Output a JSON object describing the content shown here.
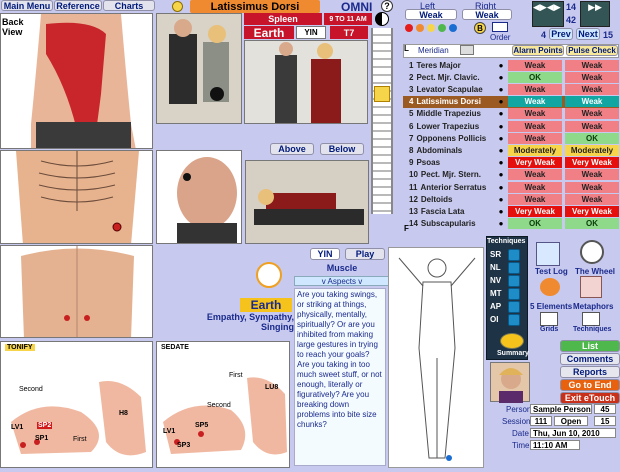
{
  "toolbar": {
    "main_menu": "Main Menu",
    "reference": "Reference",
    "charts": "Charts"
  },
  "header": {
    "muscle_title": "Latissimus Dorsi",
    "brand": "OMNI",
    "help": "?"
  },
  "back_view": "Back View",
  "organ": {
    "name": "Spleen",
    "time": "9 TO 11 AM",
    "element": "Earth",
    "yin": "YIN",
    "vertebra": "T7"
  },
  "sides": {
    "left_label": "Left",
    "right_label": "Right",
    "left_value": "Weak",
    "right_value": "Weak",
    "nav_top": "14",
    "nav_bottom": "42",
    "order_label": "Order",
    "counter_left": "4",
    "prev": "Prev",
    "next": "Next",
    "counter_right": "15"
  },
  "table_header": {
    "meridian": "Meridian",
    "alarm": "Alarm Points",
    "pulse": "Pulse Check"
  },
  "rows": [
    {
      "num": "1",
      "name": "Teres Major",
      "left": "Weak",
      "right": "Weak",
      "lc": "weak",
      "rc": "weak"
    },
    {
      "num": "2",
      "name": "Pect. Mjr. Clavic.",
      "left": "OK",
      "right": "Weak",
      "lc": "ok",
      "rc": "weak"
    },
    {
      "num": "3",
      "name": "Levator Scapulae",
      "left": "Weak",
      "right": "Weak",
      "lc": "weak",
      "rc": "weak"
    },
    {
      "num": "4",
      "name": "Latissimus Dorsi",
      "left": "Weak",
      "right": "Weak",
      "lc": "sel",
      "rc": "sel"
    },
    {
      "num": "5",
      "name": "Middle Trapezius",
      "left": "Weak",
      "right": "Weak",
      "lc": "weak",
      "rc": "weak"
    },
    {
      "num": "6",
      "name": "Lower Trapezius",
      "left": "Weak",
      "right": "Weak",
      "lc": "weak",
      "rc": "weak"
    },
    {
      "num": "7",
      "name": "Opponens Pollicis",
      "left": "Weak",
      "right": "OK",
      "lc": "weak",
      "rc": "ok"
    },
    {
      "num": "8",
      "name": "Abdominals",
      "left": "Moderately",
      "right": "Moderately",
      "lc": "mod",
      "rc": "mod"
    },
    {
      "num": "9",
      "name": "Psoas",
      "left": "Very Weak",
      "right": "Very Weak",
      "lc": "vweak",
      "rc": "vweak"
    },
    {
      "num": "10",
      "name": "Pect. Mjr. Stern.",
      "left": "Weak",
      "right": "Weak",
      "lc": "weak",
      "rc": "weak"
    },
    {
      "num": "11",
      "name": "Anterior Serratus",
      "left": "Weak",
      "right": "Weak",
      "lc": "weak",
      "rc": "weak"
    },
    {
      "num": "12",
      "name": "Deltoids",
      "left": "Weak",
      "right": "Weak",
      "lc": "weak",
      "rc": "weak"
    },
    {
      "num": "13",
      "name": "Fascia Lata",
      "left": "Very Weak",
      "right": "Very Weak",
      "lc": "vweak",
      "rc": "vweak"
    },
    {
      "num": "14",
      "name": "Subscapularis",
      "left": "OK",
      "right": "OK",
      "lc": "ok",
      "rc": "ok"
    }
  ],
  "row_f": "F",
  "row_l": "L",
  "above_below": {
    "above": "Above",
    "below": "Below"
  },
  "yin_play": {
    "yin": "YIN",
    "play": "Play"
  },
  "muscle_tab": "Muscle",
  "aspects": "v Aspects v",
  "emotion": {
    "element": "Earth",
    "traits": "Empathy, Sympathy, Singing"
  },
  "aspect_text": "Are you taking swings, or striking at things, physically, mentally, spiritually? Or are you inhibited from making large gestures in trying to reach your goals? Are you taking in too much sweet stuff, or not enough, literally or figuratively? Are you breaking down problems into bite size chunks?",
  "tonify": {
    "title": "TONIFY",
    "labels": [
      "Second",
      "First",
      "LV1",
      "SP2",
      "SP1",
      "H8"
    ]
  },
  "sedate": {
    "title": "SEDATE",
    "labels": [
      "First",
      "Second",
      "LU8",
      "SP5",
      "LV1",
      "SP3"
    ]
  },
  "techniques": {
    "title": "Techniques",
    "items": [
      "SR",
      "NL",
      "NV",
      "MT",
      "AP",
      "OI"
    ],
    "summary": "Summary"
  },
  "tools": {
    "test_log": "Test Log",
    "the_wheel": "The Wheel",
    "five_elements": "5 Elements",
    "metaphors": "Metaphors",
    "grids": "Grids",
    "techniques": "Techniques"
  },
  "actions": {
    "list": "List",
    "comments": "Comments",
    "reports": "Reports",
    "go_to_end": "Go to End",
    "exit": "Exit eTouch"
  },
  "session": {
    "person_label": "Person",
    "person": "Sample Person",
    "person_num": "45",
    "session_label": "Session",
    "session_num": "111",
    "status": "Open",
    "session_count": "15",
    "date_label": "Date",
    "date": "Thu, Jun 10, 2010",
    "time_label": "Time",
    "time": "11:10 AM"
  },
  "colors": {
    "accent": "#f08a30",
    "bg": "#c7c9ee",
    "selected_row": "#9b5a22",
    "teal_cell": "#11a6a2",
    "exit": "#c9301a",
    "list": "#4fb84c"
  }
}
